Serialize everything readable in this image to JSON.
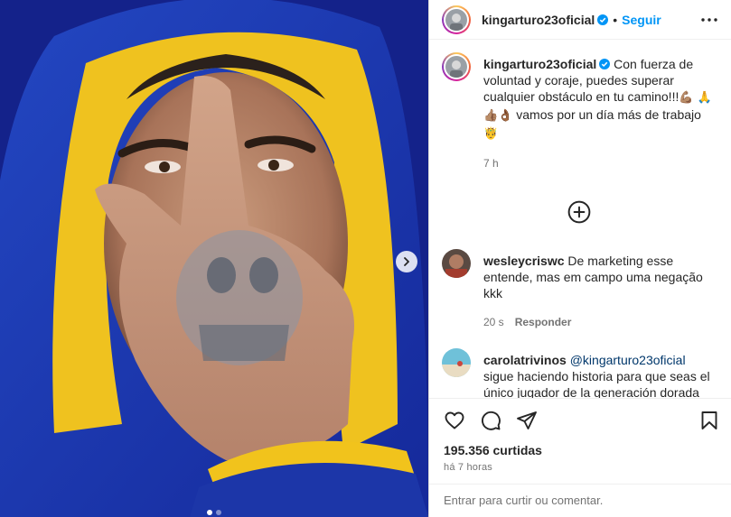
{
  "post": {
    "username": "kingarturo23oficial",
    "follow_label": "Seguir",
    "separator": "•",
    "caption": {
      "text_1": "Con fuerza de voluntad y coraje, puedes superar cualquier obstáculo en tu camino!!!",
      "emoji_1": "💪🏽",
      "emoji_2": "🙏👍🏽👌🏾",
      "text_2": " vamos por un día más de trabajo ",
      "emoji_3": "🤴",
      "time": "7 h"
    },
    "comments": [
      {
        "username": "wesleycriswc",
        "text": "De marketing esse entende, mas em campo uma negação kkk",
        "time": "20 s",
        "reply_label": "Responder"
      },
      {
        "username": "carolatrivinos",
        "mention": "@kingarturo23oficial",
        "text": "sigue haciendo historia para que seas el único jugador de la generación dorada que vuelva a competir al club de sus amores ahí te la dejo",
        "emoji": "🖖🖖"
      }
    ],
    "likes": "195.356 curtidas",
    "posted": "há 7 horas",
    "add_comment_placeholder": "Entrar para curtir ou comentar."
  },
  "icons": {
    "verified": "verified-badge-icon",
    "more": "more-options-icon",
    "load_more": "plus-circle-icon",
    "like": "heart-icon",
    "comment": "comment-bubble-icon",
    "share": "paper-plane-icon",
    "save": "bookmark-icon",
    "next": "chevron-right-icon"
  },
  "colors": {
    "accent": "#0095f6",
    "verified": "#0095f6",
    "hoodie_blue": "#1f3fb3",
    "hoodie_yellow": "#f2c21b"
  },
  "carousel": {
    "total": 2,
    "active": 1
  }
}
